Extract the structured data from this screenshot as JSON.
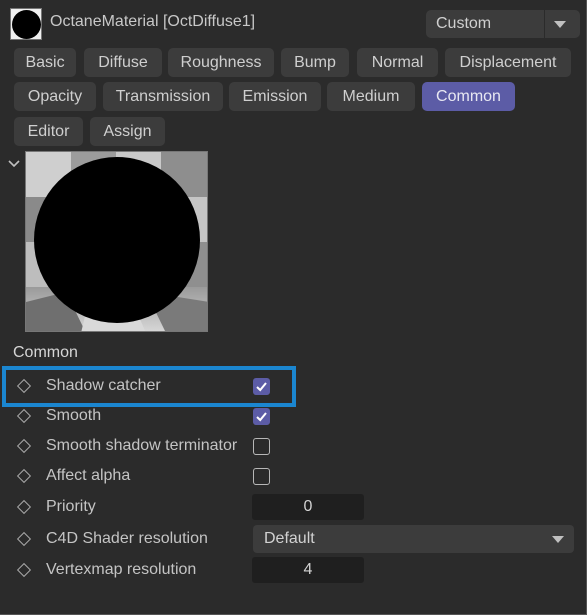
{
  "header": {
    "title": "OctaneMaterial [OctDiffuse1]",
    "preset_value": "Custom",
    "material_icon": "sphere-preview-icon"
  },
  "tabs": [
    {
      "label": "Basic",
      "active": false
    },
    {
      "label": "Diffuse",
      "active": false
    },
    {
      "label": "Roughness",
      "active": false
    },
    {
      "label": "Bump",
      "active": false
    },
    {
      "label": "Normal",
      "active": false
    },
    {
      "label": "Displacement",
      "active": false
    },
    {
      "label": "Opacity",
      "active": false
    },
    {
      "label": "Transmission",
      "active": false
    },
    {
      "label": "Emission",
      "active": false
    },
    {
      "label": "Medium",
      "active": false
    },
    {
      "label": "Common",
      "active": true
    },
    {
      "label": "Editor",
      "active": false
    },
    {
      "label": "Assign",
      "active": false
    }
  ],
  "section": {
    "title": "Common"
  },
  "properties": {
    "shadow_catcher": {
      "label": "Shadow catcher",
      "checked": true
    },
    "smooth": {
      "label": "Smooth",
      "checked": true
    },
    "smooth_shadow_terminator": {
      "label": "Smooth shadow terminator",
      "checked": false
    },
    "affect_alpha": {
      "label": "Affect alpha",
      "checked": false
    },
    "priority": {
      "label": "Priority",
      "value": "0"
    },
    "c4d_shader_resolution": {
      "label": "C4D Shader resolution",
      "value": "Default"
    },
    "vertexmap_resolution": {
      "label": "Vertexmap resolution",
      "value": "4"
    }
  },
  "colors": {
    "accent": "#5c5ca6",
    "highlight": "#1b86d0",
    "background": "#2b2b2b",
    "button": "#3c3c3c"
  }
}
